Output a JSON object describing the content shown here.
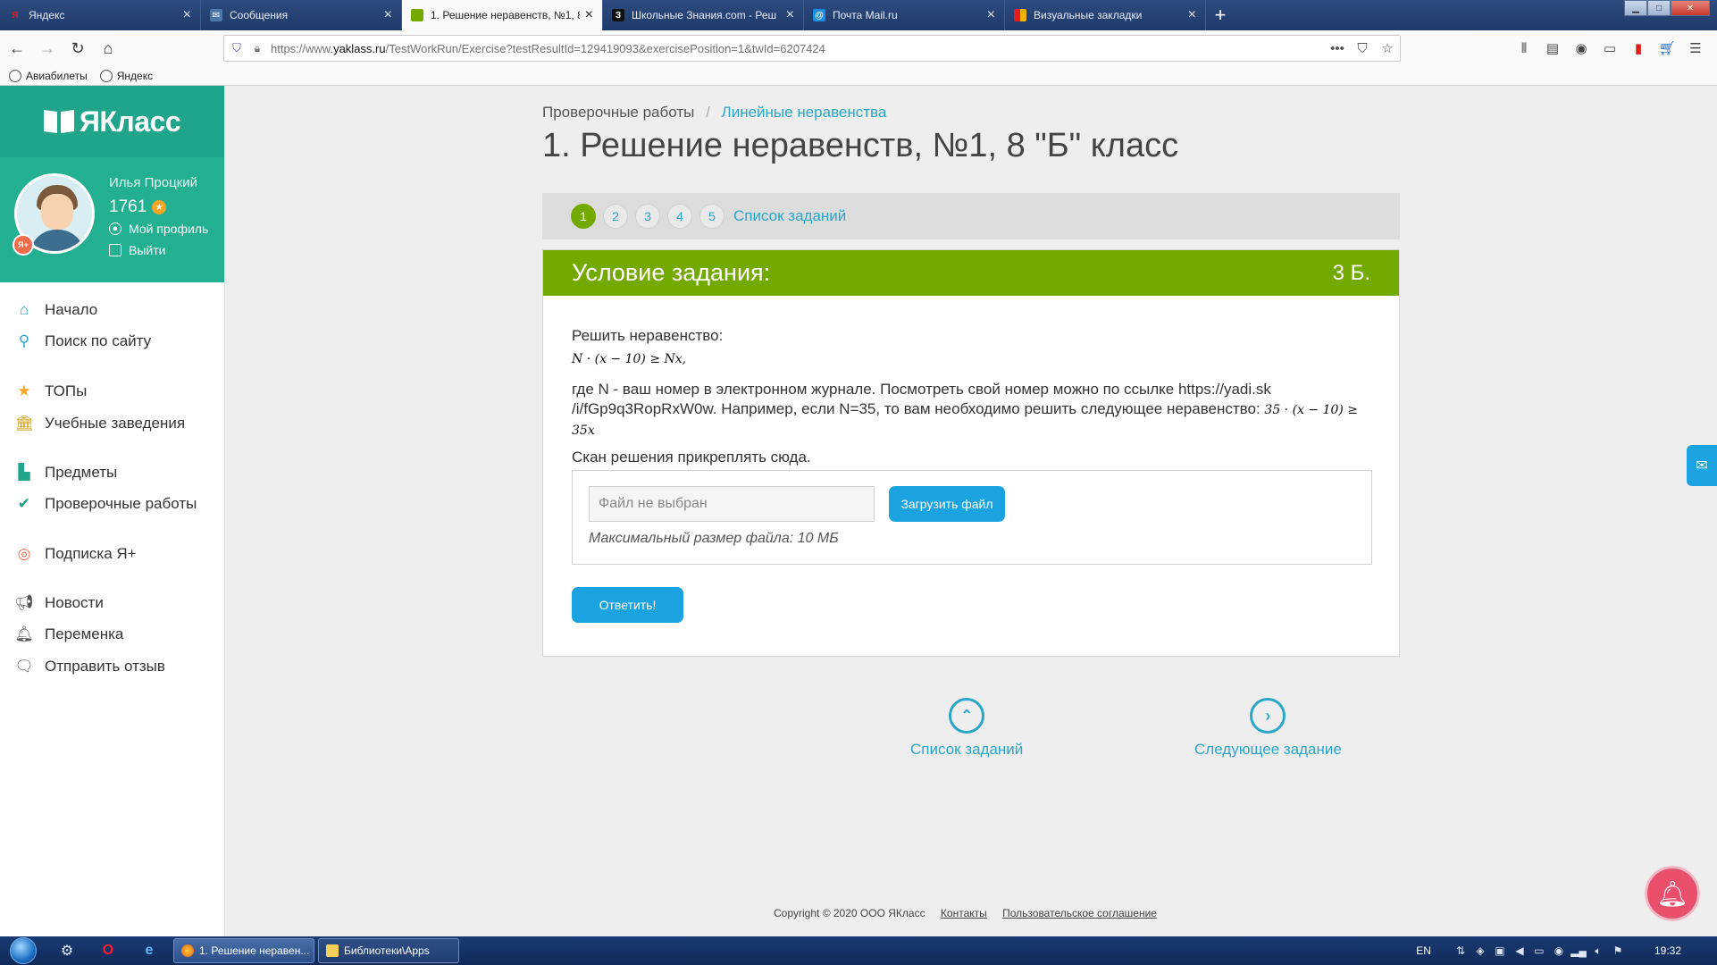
{
  "browser": {
    "tabs": [
      {
        "title": "Яндекс",
        "icon": "Я",
        "icon_color": "#e21b1b",
        "active": false
      },
      {
        "title": "Сообщения",
        "icon": "✉",
        "icon_color": "#4a76a8",
        "active": false
      },
      {
        "title": "1. Решение неравенств, №1, 8",
        "icon": "▮",
        "icon_color": "#74a900",
        "active": true
      },
      {
        "title": "Школьные Знания.com - Реш",
        "icon": "З",
        "icon_color": "#111111",
        "active": false
      },
      {
        "title": "Почта Mail.ru",
        "icon": "@",
        "icon_color": "#168de2",
        "active": false
      },
      {
        "title": "Визуальные закладки",
        "icon": "▮",
        "icon_color": "#f0b400",
        "active": false
      }
    ],
    "url_prefix": "https://www.",
    "url_domain": "yaklass.ru",
    "url_rest": "/TestWorkRun/Exercise?testResultId=129419093&exercisePosition=1&twId=6207424",
    "bookmarks": [
      "Авиабилеты",
      "Яндекс"
    ]
  },
  "sidebar": {
    "logo": "ЯКласс",
    "user_name": "Илья Процкий",
    "points": "1761",
    "badge": "Я+",
    "profile_link": "Мой профиль",
    "logout_link": "Выйти",
    "menu": [
      {
        "label": "Начало",
        "icon": "home-icon",
        "color": "#2aa6c8"
      },
      {
        "label": "Поиск по сайту",
        "icon": "search-icon",
        "color": "#2aa6c8"
      },
      {
        "label": "ТОПы",
        "icon": "star-icon",
        "color": "#f5a623"
      },
      {
        "label": "Учебные заведения",
        "icon": "school-icon",
        "color": "#d4a017"
      },
      {
        "label": "Предметы",
        "icon": "book-icon",
        "color": "#21a58a"
      },
      {
        "label": "Проверочные работы",
        "icon": "check-icon",
        "color": "#21a58a"
      },
      {
        "label": "Подписка Я+",
        "icon": "subscription-icon",
        "color": "#f26b4b"
      },
      {
        "label": "Новости",
        "icon": "megaphone-icon",
        "color": "#555555"
      },
      {
        "label": "Переменка",
        "icon": "bell-icon",
        "color": "#555555"
      },
      {
        "label": "Отправить отзыв",
        "icon": "feedback-icon",
        "color": "#555555"
      }
    ]
  },
  "main": {
    "breadcrumb_home": "Проверочные работы",
    "breadcrumb_current": "Линейные неравенства",
    "title": "1. Решение неравенств, №1, 8 \"Б\" класс",
    "question_numbers": [
      "1",
      "2",
      "3",
      "4",
      "5"
    ],
    "current_question": "1",
    "task_list_link": "Список заданий",
    "task_header": "Условие задания:",
    "task_points": "3 Б.",
    "task_text_1": "Решить неравенство:",
    "formula_1": "N · (x − 10) ≥ Nx,",
    "task_text_2a": "где N - ваш номер в электронном журнале. Посмотреть свой номер можно по ссылке https://yadi.sk",
    "task_text_2b": "/i/fGp9q3RopRxW0w. Например, если N=35, то вам необходимо решить следующее неравенство:",
    "formula_2": "35 · (x − 10) ≥ 35x",
    "task_text_3": "Скан решения прикреплять сюда.",
    "file_placeholder": "Файл не выбран",
    "upload_button": "Загрузить файл",
    "max_size": "Максимальный размер файла: 10 МБ",
    "answer_button": "Ответить!",
    "nav_list": "Список заданий",
    "nav_next": "Следующее задание"
  },
  "footer": {
    "copyright": "Copyright © 2020 ООО ЯКласс",
    "contacts": "Контакты",
    "agreement": "Пользовательское соглашение"
  },
  "taskbar": {
    "tasks": [
      "1. Решение неравен...",
      "Библиотеки\\Apps"
    ],
    "lang": "EN",
    "time": "19:32"
  },
  "colors": {
    "brand_green": "#21a58a",
    "task_green": "#74a900",
    "link_blue": "#2aa6c8",
    "button_blue": "#1aa3e0"
  }
}
